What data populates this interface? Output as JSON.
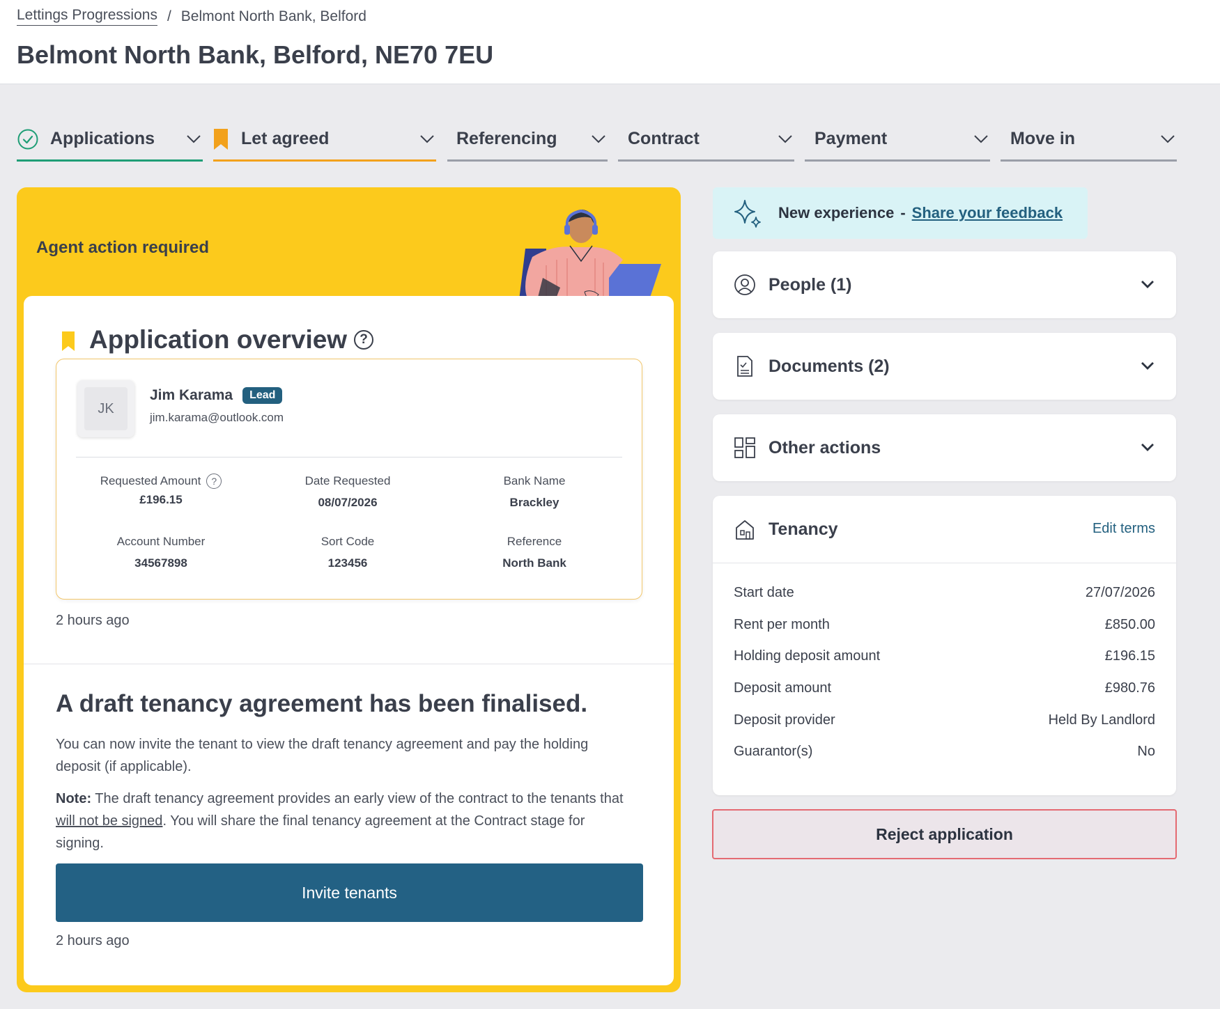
{
  "breadcrumb": {
    "link": "Lettings Progressions",
    "separator": "/",
    "current": "Belmont North Bank, Belford"
  },
  "page_title": "Belmont North Bank, Belford, NE70 7EU",
  "stages": [
    {
      "label": "Applications",
      "status": "done"
    },
    {
      "label": "Let agreed",
      "status": "current"
    },
    {
      "label": "Referencing",
      "status": "pending"
    },
    {
      "label": "Contract",
      "status": "pending"
    },
    {
      "label": "Payment",
      "status": "pending"
    },
    {
      "label": "Move in",
      "status": "pending"
    }
  ],
  "left_card": {
    "banner": "Agent action required",
    "overview_title": "Application overview",
    "help_glyph": "?",
    "applicant": {
      "initials": "JK",
      "name": "Jim Karama",
      "badge": "Lead",
      "email": "jim.karama@outlook.com"
    },
    "fields": [
      {
        "label": "Requested Amount",
        "value": "£196.15",
        "help": true
      },
      {
        "label": "Date Requested",
        "value": "08/07/2026"
      },
      {
        "label": "Bank Name",
        "value": "Brackley"
      },
      {
        "label": "Account Number",
        "value": "34567898"
      },
      {
        "label": "Sort Code",
        "value": "123456"
      },
      {
        "label": "Reference",
        "value": "North Bank"
      }
    ],
    "time_ago_1": "2 hours ago",
    "draft_heading": "A draft tenancy agreement has been finalised.",
    "para1": "You can now invite the tenant to view the draft tenancy agreement and pay the holding deposit (if applicable).",
    "note_label": "Note:",
    "note_part1": " The draft tenancy agreement provides an early view of the contract to the tenants that ",
    "note_underlined": "will not be signed",
    "note_part2": ". You will share the final tenancy agreement at the Contract stage for signing.",
    "invite_button": "Invite tenants",
    "time_ago_2": "2 hours ago"
  },
  "feedback": {
    "text": "New experience",
    "separator": "-",
    "link": "Share your feedback"
  },
  "panels": {
    "people": "People (1)",
    "documents": "Documents (2)",
    "other_actions": "Other actions"
  },
  "tenancy": {
    "title": "Tenancy",
    "edit": "Edit terms",
    "rows": [
      {
        "label": "Start date",
        "value": "27/07/2026"
      },
      {
        "label": "Rent per month",
        "value": "£850.00"
      },
      {
        "label": "Holding deposit amount",
        "value": "£196.15"
      },
      {
        "label": "Deposit amount",
        "value": "£980.76"
      },
      {
        "label": "Deposit provider",
        "value": "Held By Landlord"
      },
      {
        "label": "Guarantor(s)",
        "value": "No"
      }
    ]
  },
  "reject_button": "Reject application",
  "colors": {
    "accent_teal": "#1f9e76",
    "accent_orange": "#f2a11c",
    "banner_yellow": "#fcca1c",
    "primary_button": "#236184",
    "danger_border": "#e46a72"
  },
  "icons": [
    "check-circle-icon",
    "bookmark-icon",
    "chevron-down-icon",
    "help-icon",
    "sparkle-icon",
    "person-circle-icon",
    "document-icon",
    "grid-icon",
    "house-icon"
  ]
}
